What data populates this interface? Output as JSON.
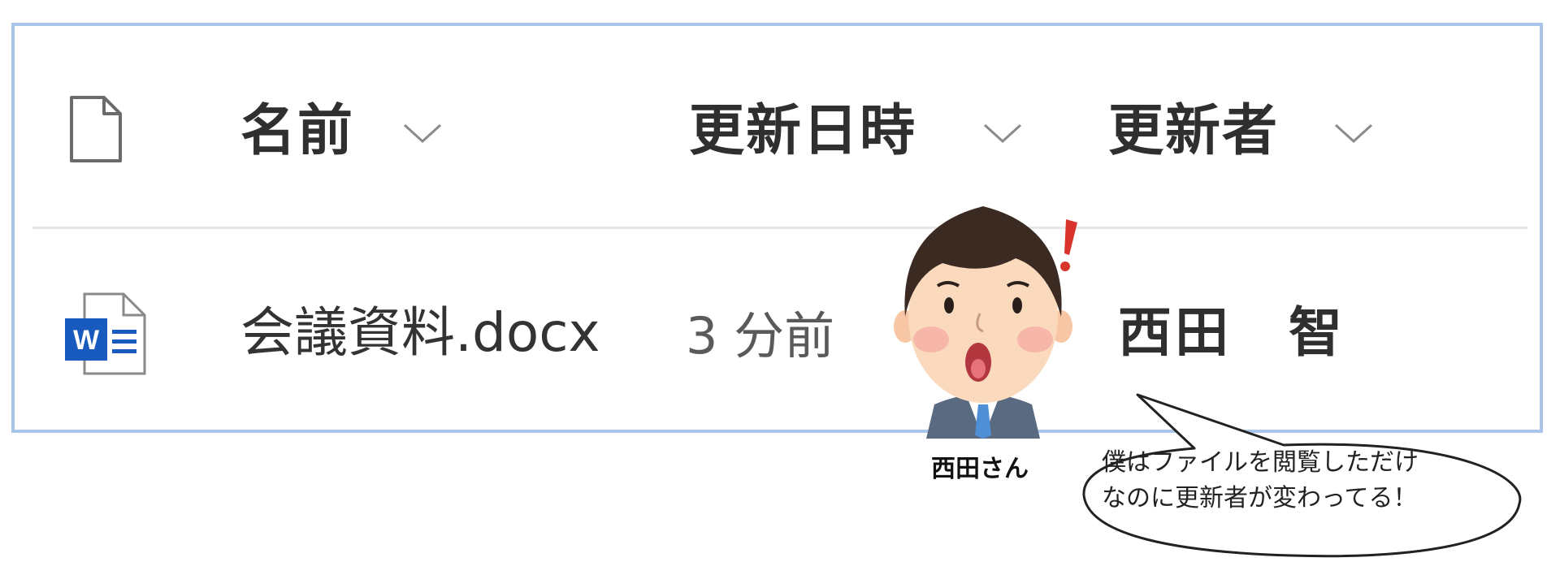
{
  "columns": {
    "file_type_icon": "document-icon",
    "name": "名前",
    "modified": "更新日時",
    "modified_by": "更新者"
  },
  "file": {
    "icon": "word-document-icon",
    "name": "会議資料.docx",
    "modified": "3 分前",
    "modified_by": "西田　智"
  },
  "character": {
    "label": "西田さん",
    "speech": "僕はファイルを閲覧しただけ\nなのに更新者が変わってる！"
  },
  "colors": {
    "frame": "#a9c6e8",
    "word_blue": "#185abd",
    "exclamation": "#d9342b"
  }
}
